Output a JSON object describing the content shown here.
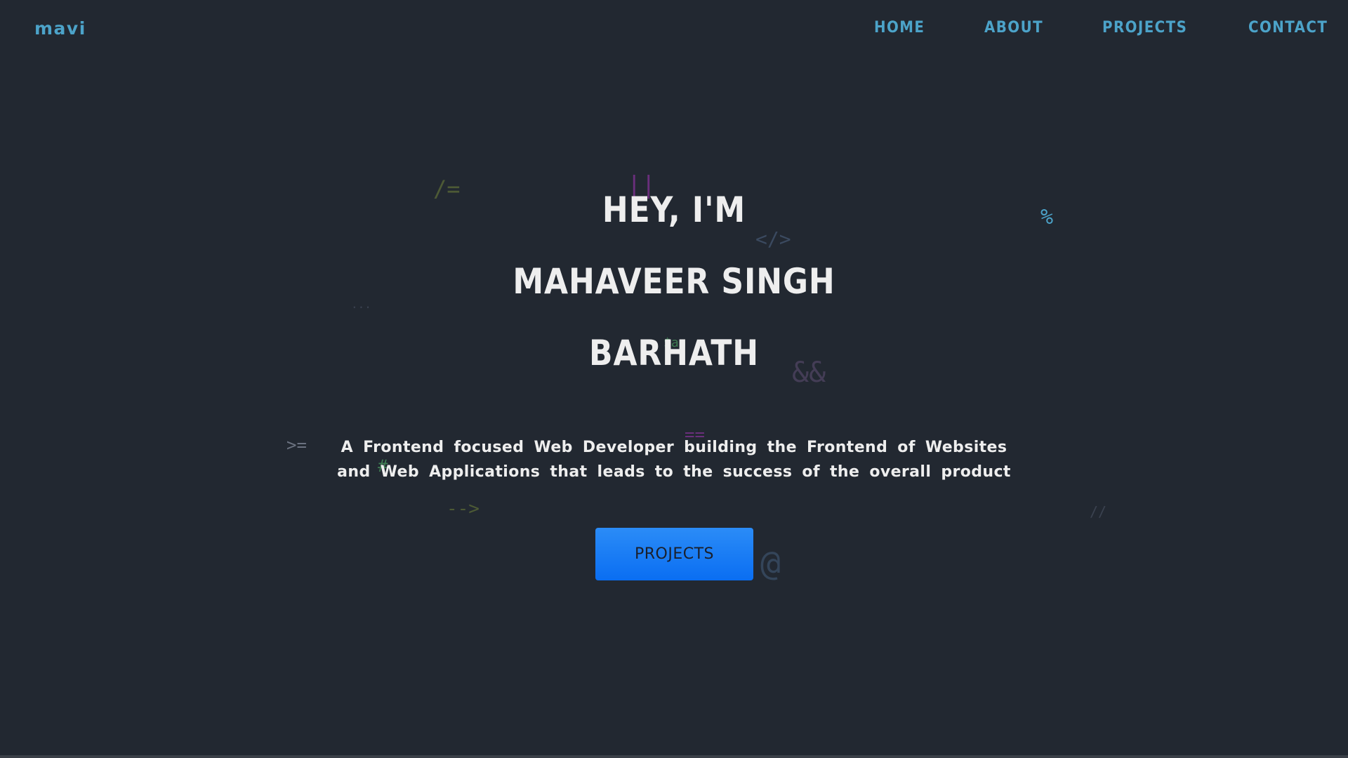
{
  "nav": {
    "logo": "mavi",
    "links": [
      "HOME",
      "ABOUT",
      "PROJECTS",
      "CONTACT"
    ]
  },
  "hero": {
    "line1": "HEY, I'M",
    "line2": "MAHAVEER SINGH",
    "line3": "BARHATH",
    "description": "A Frontend focused Web Developer building the Frontend of Websites and Web Applications that leads to the success of the overall product",
    "cta_label": "PROJECTS"
  },
  "decor": {
    "symbols": [
      "/=",
      "||",
      "</>",
      "%",
      "...",
      "$aa",
      "&&",
      ">=",
      "==",
      "#",
      "-->",
      "//",
      "@"
    ]
  },
  "colors": {
    "background": "#222831",
    "accent": "#4ca3c9",
    "button": "#0a6ef2",
    "text": "#eeeeee"
  }
}
